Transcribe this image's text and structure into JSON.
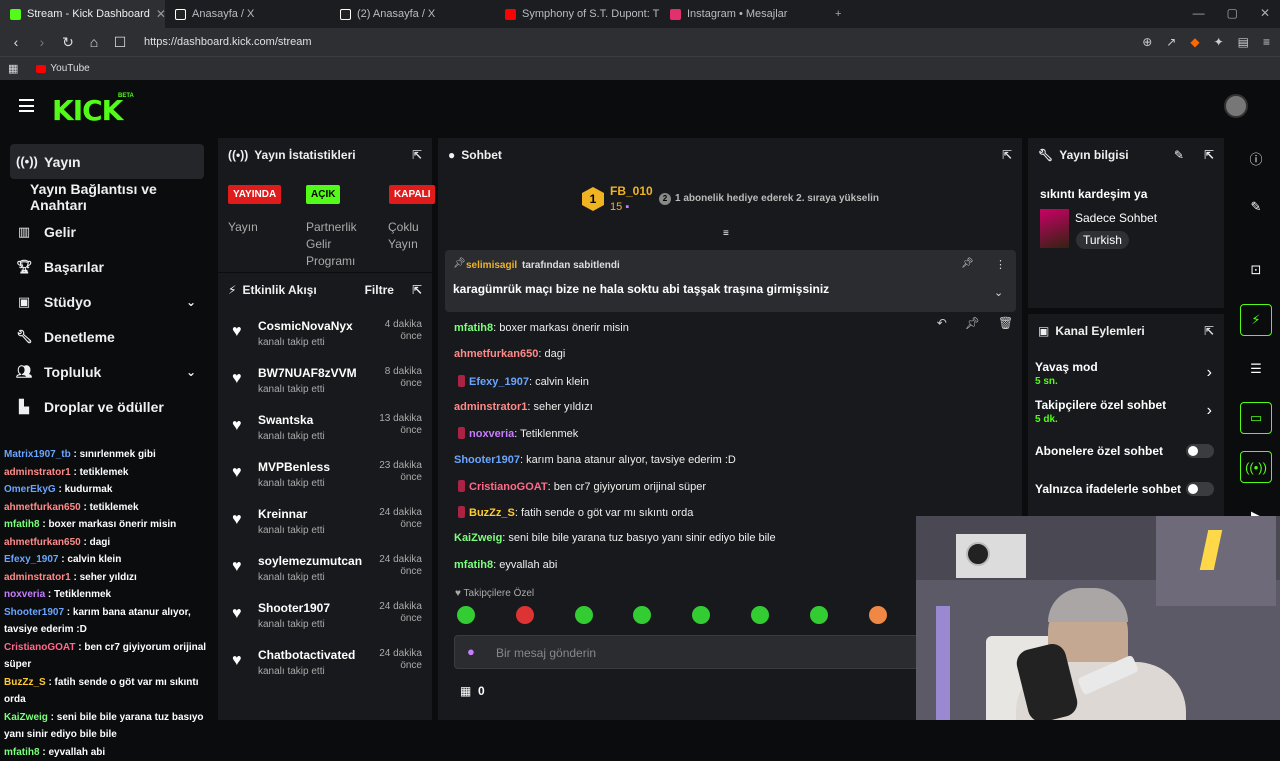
{
  "browser": {
    "tabs": [
      {
        "title": "Stream - Kick Dashboard",
        "color": "#53fc18"
      },
      {
        "title": "Anasayfa / X",
        "color": "#ffffff"
      },
      {
        "title": "(2) Anasayfa / X",
        "color": "#ffffff"
      },
      {
        "title": "Symphony of S.T. Dupont: The Encha",
        "color": "#ff0000"
      },
      {
        "title": "Instagram • Mesajlar",
        "color": "#e1306c"
      }
    ],
    "url": "https://dashboard.kick.com/stream",
    "bookmark": "YouTube"
  },
  "logo": "KICK",
  "beta": "BETA",
  "nav": {
    "items": [
      {
        "label": "Yayın",
        "icon": "broadcast-icon"
      },
      {
        "label": "Yayın Bağlantısı ve Anahtarı",
        "icon": ""
      },
      {
        "label": "Gelir",
        "icon": "chart-icon"
      },
      {
        "label": "Başarılar",
        "icon": "trophy-icon"
      },
      {
        "label": "Stüdyo",
        "icon": "studio-icon"
      },
      {
        "label": "Denetleme",
        "icon": "wrench-icon"
      },
      {
        "label": "Topluluk",
        "icon": "people-icon"
      },
      {
        "label": "Droplar ve ödüller",
        "icon": "gift-icon"
      }
    ]
  },
  "sidechat": [
    {
      "user": "Matrix1907_tb",
      "text": " : sınırlenmek gibi",
      "color": "#6aa5ff"
    },
    {
      "user": "adminstrator1",
      "text": " : tetiklemek",
      "color": "#ff8a8a"
    },
    {
      "user": "OmerEkyG",
      "text": " : kudurmak",
      "color": "#6aa5ff"
    },
    {
      "user": "ahmetfurkan650",
      "text": " : tetiklemek",
      "color": "#ff8a8a"
    },
    {
      "user": "mfatih8",
      "text": " : boxer markası önerir misin",
      "color": "#7cff7c"
    },
    {
      "user": "ahmetfurkan650",
      "text": " : dagi",
      "color": "#ff8a8a"
    },
    {
      "user": "Efexy_1907",
      "text": " : calvin klein",
      "color": "#6aa5ff"
    },
    {
      "user": "adminstrator1",
      "text": " : seher yıldızı",
      "color": "#ff8a8a"
    },
    {
      "user": "noxveria",
      "text": " : Tetiklenmek",
      "color": "#c77dff"
    },
    {
      "user": "Shooter1907",
      "text": " : karım bana atanur alıyor, tavsiye ederim :D",
      "color": "#6aa5ff"
    },
    {
      "user": "CristianoGOAT",
      "text": " : ben cr7 giyiyorum orijinal süper",
      "color": "#ff6a8a"
    },
    {
      "user": "BuzZz_S",
      "text": " : fatih sende o göt var mı sıkıntı orda",
      "color": "#ffcc33"
    },
    {
      "user": "KaiZweig",
      "text": " : seni bile bile yarana tuz basıyo yanı sinir ediyo bile bile",
      "color": "#7cff7c"
    },
    {
      "user": "mfatih8",
      "text": " : eyvallah abi",
      "color": "#7cff7c"
    }
  ],
  "stats": {
    "title": "Yayın İstatistikleri",
    "badges": [
      {
        "label": "YAYINDA",
        "bg": "#e01b1b",
        "fg": "#ffffff",
        "caption": "Yayın"
      },
      {
        "label": "AÇIK",
        "bg": "#53fc18",
        "fg": "#000000",
        "caption": "Partnerlik Gelir Programı"
      },
      {
        "label": "KAPALI",
        "bg": "#e01b1b",
        "fg": "#ffffff",
        "caption": "Çoklu Yayın"
      }
    ]
  },
  "activity": {
    "title": "Etkinlik Akışı",
    "filter": "Filtre",
    "events": [
      {
        "name": "CosmicNovaNyx",
        "time": "4 dakika önce",
        "action": "kanalı takip etti"
      },
      {
        "name": "BW7NUAF8zVVM",
        "time": "8 dakika önce",
        "action": "kanalı takip etti"
      },
      {
        "name": "Swantska",
        "time": "13 dakika önce",
        "action": "kanalı takip etti"
      },
      {
        "name": "MVPBenless",
        "time": "23 dakika önce",
        "action": "kanalı takip etti"
      },
      {
        "name": "Kreinnar",
        "time": "24 dakika önce",
        "action": "kanalı takip etti"
      },
      {
        "name": "soylemezumutcan",
        "time": "24 dakika önce",
        "action": "kanalı takip etti"
      },
      {
        "name": "Shooter1907",
        "time": "24 dakika önce",
        "action": "kanalı takip etti"
      },
      {
        "name": "Chatbotactivated",
        "time": "24 dakika önce",
        "action": "kanalı takip etti"
      }
    ]
  },
  "chat": {
    "title": "Sohbet",
    "top_user": "FB_010",
    "top_rank": "1",
    "top_count": "15",
    "gift_rank": "2",
    "gift_text": "1 abonelik hediye ederek 2. sıraya yükselin",
    "pinned_by": "selimisagil",
    "pinned_suffix": "tarafından sabitlendi",
    "pinned_text": "karagümrük maçı bize ne hala soktu abi taşşak traşına girmişsiniz",
    "messages": [
      {
        "user": "mfatih8",
        "text": ": boxer markası önerir misin",
        "color": "#7cff7c",
        "badge": false
      },
      {
        "user": "ahmetfurkan650",
        "text": ": dagi",
        "color": "#ff8a8a",
        "badge": false
      },
      {
        "user": "Efexy_1907",
        "text": ": calvin klein",
        "color": "#6aa5ff",
        "badge": true
      },
      {
        "user": "adminstrator1",
        "text": ": seher yıldızı",
        "color": "#ff8a8a",
        "badge": false
      },
      {
        "user": "noxveria",
        "text": ": Tetiklenmek",
        "color": "#c77dff",
        "badge": true
      },
      {
        "user": "Shooter1907",
        "text": ": karım bana atanur alıyor, tavsiye ederim :D",
        "color": "#6aa5ff",
        "badge": false
      },
      {
        "user": "CristianoGOAT",
        "text": ": ben cr7 giyiyorum orijinal süper",
        "color": "#ff6a8a",
        "badge": true
      },
      {
        "user": "BuzZz_S",
        "text": ": fatih sende o göt var mı sıkıntı orda",
        "color": "#ffcc33",
        "badge": true
      },
      {
        "user": "KaiZweig",
        "text": ": seni bile bile yarana tuz basıyo yanı sinir ediyo bile bile",
        "color": "#7cff7c",
        "badge": false
      },
      {
        "user": "mfatih8",
        "text": ": eyvallah abi",
        "color": "#7cff7c",
        "badge": false
      }
    ],
    "followers_only": "Takipçilere Özel",
    "placeholder": "Bir mesaj gönderin",
    "points": "0"
  },
  "info": {
    "title": "Yayın bilgisi",
    "stream_title": "sıkıntı kardeşim ya",
    "category": "Sadece Sohbet",
    "language": "Turkish"
  },
  "actions": {
    "title": "Kanal Eylemleri",
    "items": [
      {
        "label": "Yavaş mod",
        "value": "5 sn."
      },
      {
        "label": "Takipçilere özel sohbet",
        "value": "5 dk."
      },
      {
        "label": "Abonelere özel sohbet",
        "value": ""
      },
      {
        "label": "Yalnızca ifadelerle sohbet",
        "value": ""
      }
    ]
  }
}
